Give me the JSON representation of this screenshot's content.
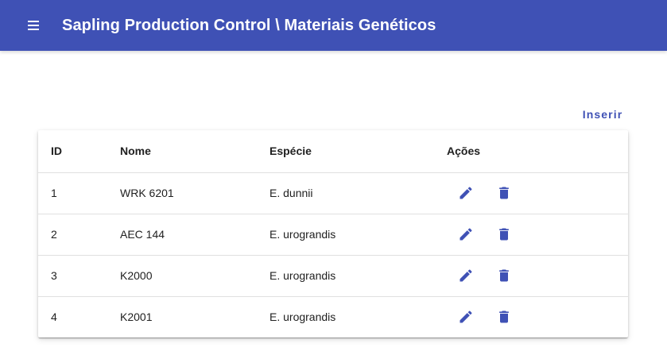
{
  "header": {
    "title": "Sapling Production Control \\ Materiais Genéticos",
    "menu_icon": "menu-icon",
    "bg_color": "#3f51b5"
  },
  "toolbar": {
    "insert_label": "Inserir"
  },
  "table": {
    "columns": [
      "ID",
      "Nome",
      "Espécie",
      "Ações"
    ],
    "rows": [
      {
        "id": "1",
        "nome": "WRK 6201",
        "especie": "E. dunnii"
      },
      {
        "id": "2",
        "nome": "AEC 144",
        "especie": "E. urograndis"
      },
      {
        "id": "3",
        "nome": "K2000",
        "especie": "E. urograndis"
      },
      {
        "id": "4",
        "nome": "K2001",
        "especie": "E. urograndis"
      }
    ],
    "row_actions": [
      "edit-icon",
      "delete-icon"
    ],
    "accent_color": "#3f51b5"
  }
}
